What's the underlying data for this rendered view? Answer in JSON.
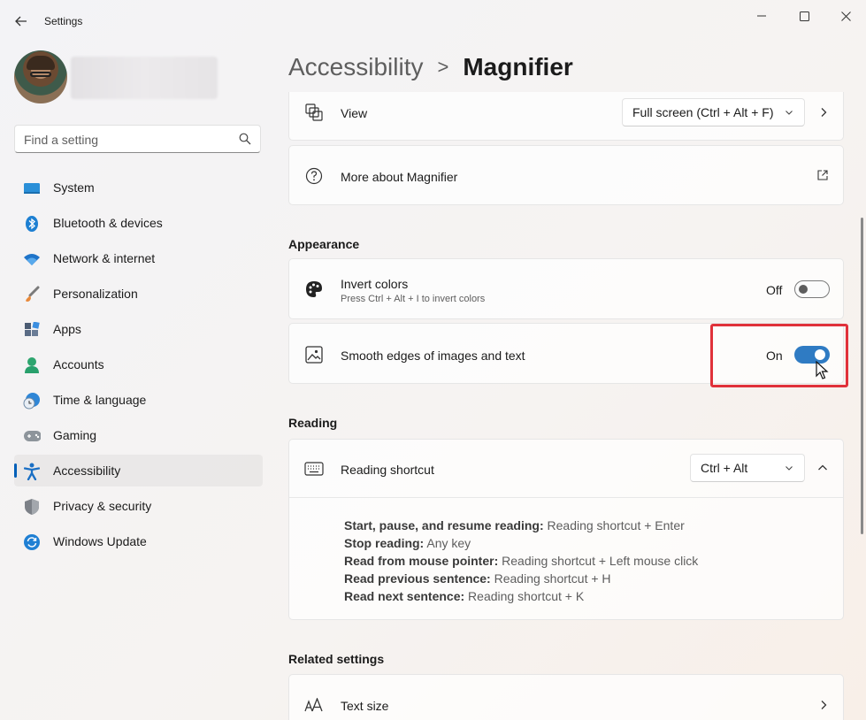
{
  "window": {
    "title": "Settings"
  },
  "search": {
    "placeholder": "Find a setting"
  },
  "sidebar": {
    "items": [
      {
        "label": "System",
        "icon": "system-icon"
      },
      {
        "label": "Bluetooth & devices",
        "icon": "bluetooth-icon"
      },
      {
        "label": "Network & internet",
        "icon": "wifi-icon"
      },
      {
        "label": "Personalization",
        "icon": "brush-icon"
      },
      {
        "label": "Apps",
        "icon": "apps-icon"
      },
      {
        "label": "Accounts",
        "icon": "accounts-icon"
      },
      {
        "label": "Time & language",
        "icon": "time-language-icon"
      },
      {
        "label": "Gaming",
        "icon": "gamepad-icon"
      },
      {
        "label": "Accessibility",
        "icon": "accessibility-icon",
        "active": true
      },
      {
        "label": "Privacy & security",
        "icon": "shield-icon"
      },
      {
        "label": "Windows Update",
        "icon": "update-icon"
      }
    ]
  },
  "breadcrumb": {
    "parent": "Accessibility",
    "separator": ">",
    "current": "Magnifier"
  },
  "view_row": {
    "label": "View",
    "dropdown_value": "Full screen (Ctrl + Alt + F)"
  },
  "more_row": {
    "label": "More about Magnifier"
  },
  "appearance": {
    "title": "Appearance",
    "invert": {
      "label": "Invert colors",
      "description": "Press Ctrl + Alt + I to invert colors",
      "state_text": "Off",
      "on": false
    },
    "smooth": {
      "label": "Smooth edges of images and text",
      "state_text": "On",
      "on": true
    }
  },
  "reading": {
    "title": "Reading",
    "shortcut": {
      "label": "Reading shortcut",
      "dropdown_value": "Ctrl + Alt"
    },
    "details": [
      {
        "key": "Start, pause, and resume reading:",
        "value": " Reading shortcut + Enter"
      },
      {
        "key": "Stop reading:",
        "value": " Any key"
      },
      {
        "key": "Read from mouse pointer:",
        "value": " Reading shortcut + Left mouse click"
      },
      {
        "key": "Read previous sentence:",
        "value": " Reading shortcut + H"
      },
      {
        "key": "Read next sentence:",
        "value": " Reading shortcut + K"
      }
    ]
  },
  "related": {
    "title": "Related settings",
    "text_size": {
      "label": "Text size"
    }
  },
  "colors": {
    "accent": "#005fb8",
    "toggle_on": "#2f7bc3",
    "highlight": "#e0313a"
  }
}
